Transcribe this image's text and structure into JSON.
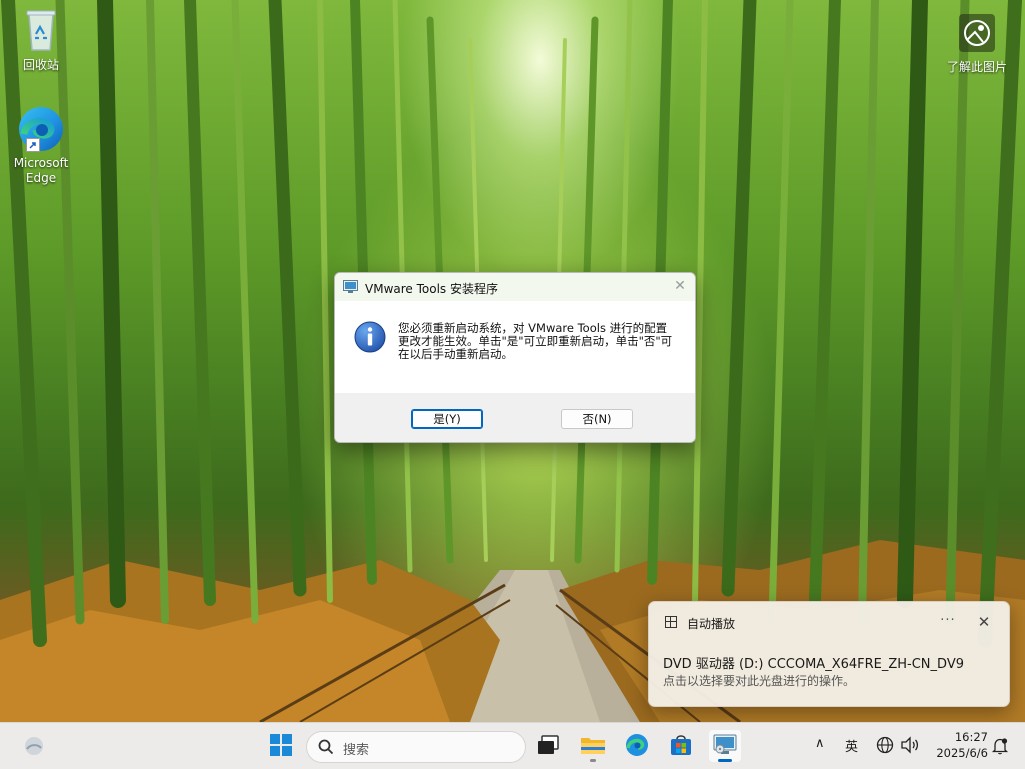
{
  "desktop": {
    "icons": [
      {
        "label": "回收站",
        "icon": "recycle-bin-icon"
      },
      {
        "label": "Microsoft Edge",
        "icon": "edge-icon"
      },
      {
        "label": "了解此图片",
        "icon": "learn-picture-icon"
      }
    ]
  },
  "dialog": {
    "title": "VMware Tools 安装程序",
    "message": "您必须重新启动系统，对 VMware Tools 进行的配置更改才能生效。单击\"是\"可立即重新启动，单击\"否\"可在以后手动重新启动。",
    "yes_label": "是(Y)",
    "no_label": "否(N)",
    "close_glyph": "✕"
  },
  "toast": {
    "title": "自动播放",
    "more_glyph": "···",
    "close_glyph": "✕",
    "drive": "DVD 驱动器 (D:) CCCOMA_X64FRE_ZH-CN_DV9",
    "action": "点击以选择要对此光盘进行的操作。"
  },
  "taskbar": {
    "search_placeholder": "搜索",
    "apps": [
      "weather-icon",
      "start-icon",
      "task-view-icon",
      "file-explorer-icon",
      "edge-icon",
      "store-icon",
      "vmware-setup-icon"
    ],
    "tray": {
      "chevron": "∧",
      "ime": "英",
      "time": "16:27",
      "date": "2025/6/6"
    }
  },
  "colors": {
    "accent": "#0067c0",
    "taskbar_bg": "#ecebe9",
    "dialog_title_bg": "#f3f8ee",
    "info_blue": "#1f5fb8"
  }
}
